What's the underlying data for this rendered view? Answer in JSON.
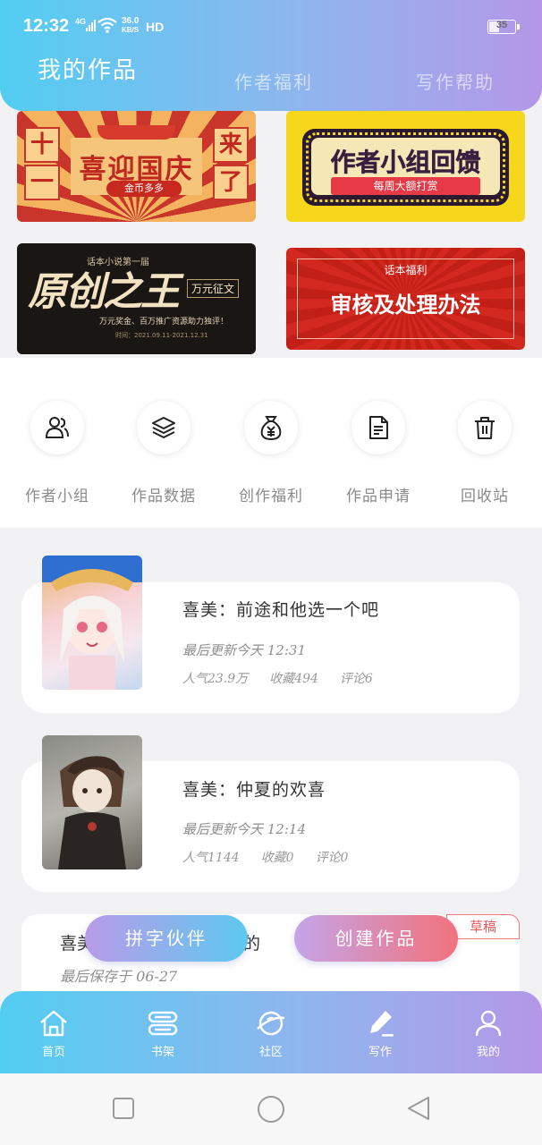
{
  "status_bar": {
    "time": "12:32",
    "network": "4G",
    "speed_value": "36.0",
    "speed_unit": "KB/S",
    "hd": "HD",
    "battery": "35"
  },
  "header": {
    "tabs": [
      "我的作品",
      "作者福利",
      "写作帮助"
    ],
    "active_tab": 0
  },
  "banners": {
    "national_day": {
      "title": "喜迎国庆",
      "subtitle": "金币多多",
      "left_chars": [
        "十",
        "一"
      ],
      "right_chars": [
        "来",
        "了"
      ]
    },
    "author_group": {
      "title": "作者小组回馈",
      "subtitle": "每周大额打赏"
    },
    "original_king": {
      "small": "话本小说第一届",
      "title": "原创之王",
      "tag": "万元征文",
      "desc": "万元奖金、百万推广资源助力独评！",
      "date": "时间：2021.09.11-2021.12.31"
    },
    "review": {
      "small": "话本福利",
      "title": "审核及处理办法"
    }
  },
  "quick_actions": [
    {
      "label": "作者小组",
      "icon": "author-group-icon"
    },
    {
      "label": "作品数据",
      "icon": "layers-icon"
    },
    {
      "label": "创作福利",
      "icon": "money-bag-icon"
    },
    {
      "label": "作品申请",
      "icon": "document-icon"
    },
    {
      "label": "回收站",
      "icon": "trash-icon"
    }
  ],
  "works": [
    {
      "title": "喜美：前途和他选一个吧",
      "updated": "最后更新今天 12:31",
      "popularity": "人气23.9万",
      "favorites": "收藏494",
      "comments": "评论6"
    },
    {
      "title": "喜美：仲夏的欢喜",
      "updated": "最后更新今天 12:14",
      "popularity": "人气1144",
      "favorites": "收藏0",
      "comments": "评论0"
    }
  ],
  "draft": {
    "badge": "草稿",
    "title_start": "喜美",
    "title_end": "的",
    "saved": "最后保存于 06-27"
  },
  "fabs": {
    "partner": "拼字伙伴",
    "create": "创建作品"
  },
  "bottom_nav": [
    {
      "label": "首页",
      "icon": "home-icon"
    },
    {
      "label": "书架",
      "icon": "bookshelf-icon"
    },
    {
      "label": "社区",
      "icon": "planet-icon"
    },
    {
      "label": "写作",
      "icon": "pen-icon"
    },
    {
      "label": "我的",
      "icon": "user-icon"
    }
  ],
  "colors": {
    "gradient_start": "#52cdf2",
    "gradient_end": "#b497e8",
    "draft_red": "#e5595a"
  }
}
